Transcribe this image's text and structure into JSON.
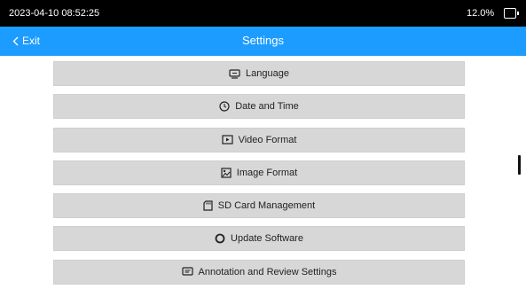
{
  "status_bar": {
    "datetime": "2023-04-10 08:52:25",
    "battery_percent": "12.0%"
  },
  "header": {
    "exit_label": "Exit",
    "title": "Settings"
  },
  "menu": {
    "items": [
      {
        "label": "Language",
        "icon": "language-icon"
      },
      {
        "label": "Date and Time",
        "icon": "clock-icon"
      },
      {
        "label": "Video Format",
        "icon": "video-icon"
      },
      {
        "label": "Image Format",
        "icon": "image-icon"
      },
      {
        "label": "SD Card Management",
        "icon": "sd-card-icon"
      },
      {
        "label": "Update Software",
        "icon": "update-icon"
      },
      {
        "label": "Annotation and Review Settings",
        "icon": "annotation-icon"
      }
    ]
  },
  "colors": {
    "status_bar_bg": "#000000",
    "header_bg": "#1d9cff",
    "menu_item_bg": "#d7d7d7"
  }
}
